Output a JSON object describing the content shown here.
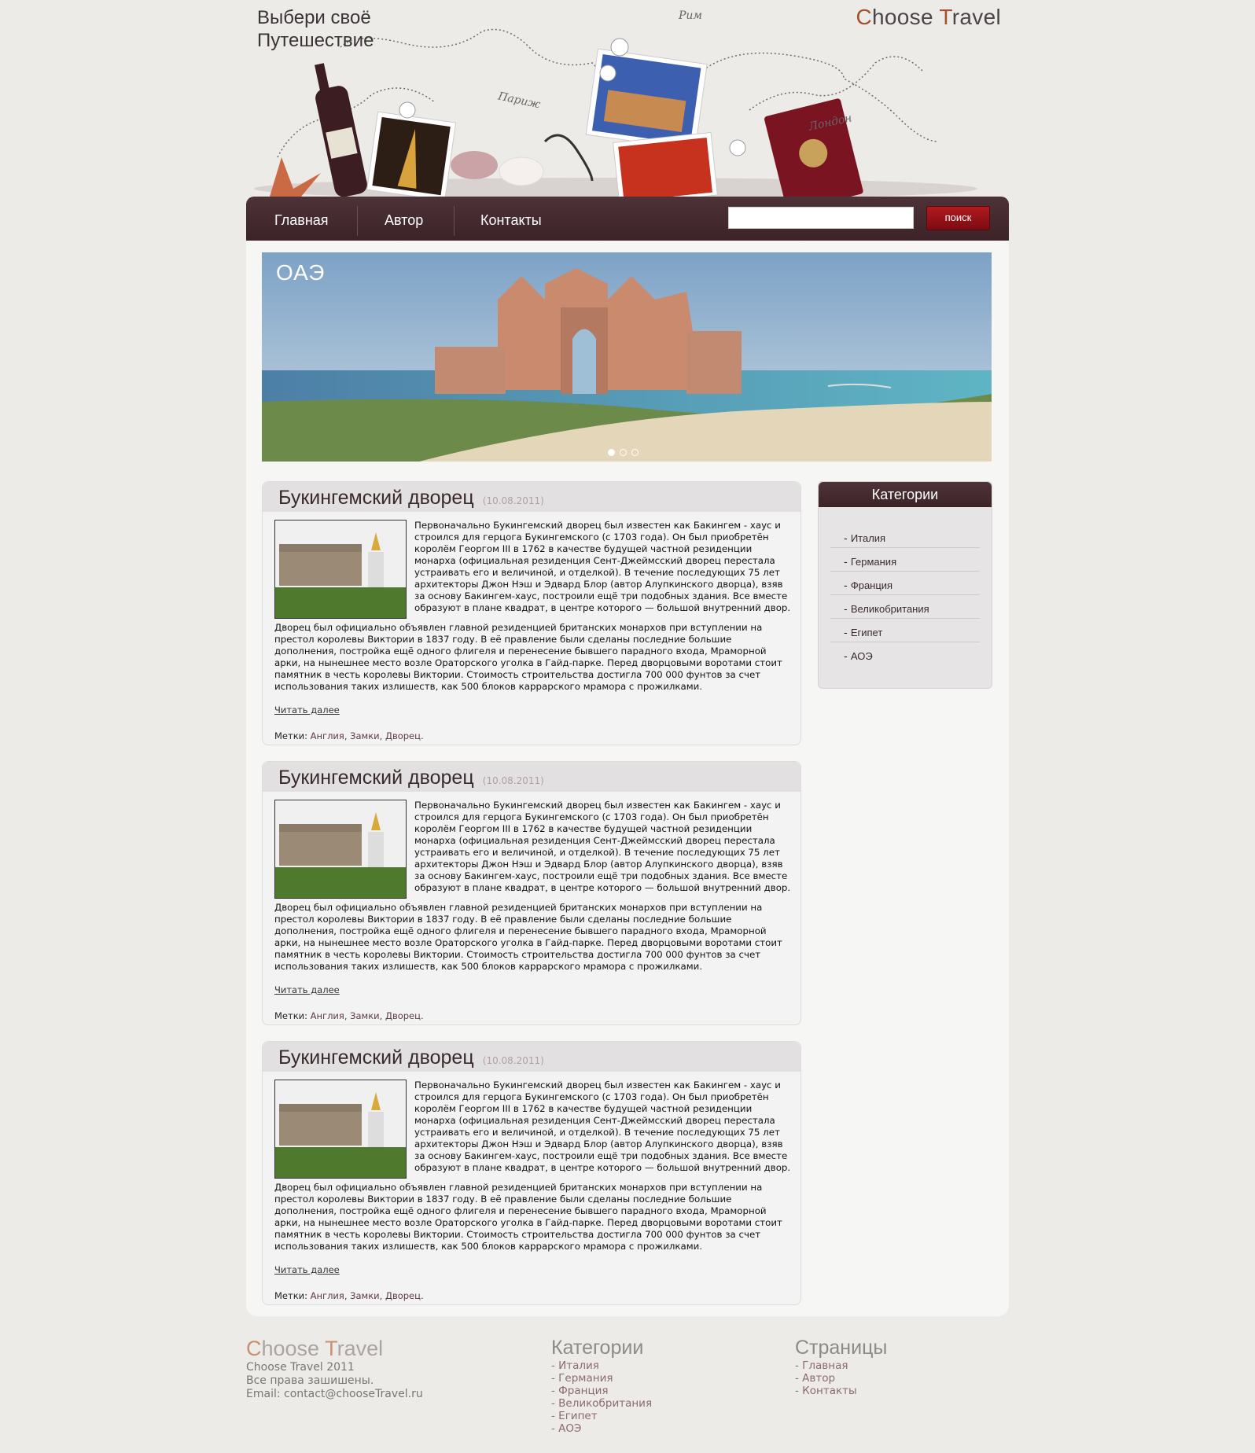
{
  "header": {
    "slogan_line1": "Выбери своё",
    "slogan_line2": "Путешествие",
    "logo_part1": "C",
    "logo_part2": "hoose ",
    "logo_part3": "T",
    "logo_part4": "ravel",
    "city_rome": "Рим",
    "city_paris": "Париж",
    "city_london": "Лондон"
  },
  "nav": {
    "items": [
      {
        "label": "Главная"
      },
      {
        "label": "Автор"
      },
      {
        "label": "Контакты"
      }
    ],
    "search_placeholder": "",
    "search_button": "поиск"
  },
  "banner": {
    "caption": "ОАЭ",
    "slide_count": 3,
    "active_slide": 1
  },
  "posts": [
    {
      "title": "Букингемский дворец",
      "date": "(10.08.2011)",
      "paragraph1": "Первоначально Букингемский дворец был известен как Бакингем - хаус и строился для герцога Букингемского (с 1703 года). Он был приобретён королём Георгом III в 1762 в качестве будущей частной резиденции монарха (официальная резиденция Сент-Джеймсский дворец перестала устраивать его и величиной, и отделкой). В течение последующих 75 лет архитекторы Джон Нэш и Эдвард Блор (автор Алупкинского дворца), взяв за основу Бакингем-хаус, построили ещё три подобных здания. Все вместе образуют в плане квадрат, в центре которого — большой внутренний двор.",
      "paragraph2": "Дворец был официально объявлен главной резиденцией британских монархов при вступлении на престол королевы Виктории в 1837 году. В её правление были сделаны последние большие дополнения, постройка ещё одного флигеля и перенесение бывшего парадного входа, Мраморной арки, на нынешнее место возле Ораторского уголка в Гайд-парке. Перед дворцовыми воротами стоит памятник в честь королевы Виктории. Стоимость строительства достигла 700 000 фунтов за счет использования таких излишеств, как 500 блоков каррарского мрамора с прожилками.",
      "read_more": "Читать далее",
      "tags_label": "Метки:",
      "tags": "Англия, Замки, Дворец."
    },
    {
      "title": "Букингемский дворец",
      "date": "(10.08.2011)",
      "paragraph1": "Первоначально Букингемский дворец был известен как Бакингем - хаус и строился для герцога Букингемского (с 1703 года). Он был приобретён королём Георгом III в 1762 в качестве будущей частной резиденции монарха (официальная резиденция Сент-Джеймсский дворец перестала устраивать его и величиной, и отделкой). В течение последующих 75 лет архитекторы Джон Нэш и Эдвард Блор (автор Алупкинского дворца), взяв за основу Бакингем-хаус, построили ещё три подобных здания. Все вместе образуют в плане квадрат, в центре которого — большой внутренний двор.",
      "paragraph2": "Дворец был официально объявлен главной резиденцией британских монархов при вступлении на престол королевы Виктории в 1837 году. В её правление были сделаны последние большие дополнения, постройка ещё одного флигеля и перенесение бывшего парадного входа, Мраморной арки, на нынешнее место возле Ораторского уголка в Гайд-парке. Перед дворцовыми воротами стоит памятник в честь королевы Виктории. Стоимость строительства достигла 700 000 фунтов за счет использования таких излишеств, как 500 блоков каррарского мрамора с прожилками.",
      "read_more": "Читать далее",
      "tags_label": "Метки:",
      "tags": "Англия, Замки, Дворец."
    },
    {
      "title": "Букингемский дворец",
      "date": "(10.08.2011)",
      "paragraph1": "Первоначально Букингемский дворец был известен как Бакингем - хаус и строился для герцога Букингемского (с 1703 года). Он был приобретён королём Георгом III в 1762 в качестве будущей частной резиденции монарха (официальная резиденция Сент-Джеймсский дворец перестала устраивать его и величиной, и отделкой). В течение последующих 75 лет архитекторы Джон Нэш и Эдвард Блор (автор Алупкинского дворца), взяв за основу Бакингем-хаус, построили ещё три подобных здания. Все вместе образуют в плане квадрат, в центре которого — большой внутренний двор.",
      "paragraph2": "Дворец был официально объявлен главной резиденцией британских монархов при вступлении на престол королевы Виктории в 1837 году. В её правление были сделаны последние большие дополнения, постройка ещё одного флигеля и перенесение бывшего парадного входа, Мраморной арки, на нынешнее место возле Ораторского уголка в Гайд-парке. Перед дворцовыми воротами стоит памятник в честь королевы Виктории. Стоимость строительства достигла 700 000 фунтов за счет использования таких излишеств, как 500 блоков каррарского мрамора с прожилками.",
      "read_more": "Читать далее",
      "tags_label": "Метки:",
      "tags": "Англия, Замки, Дворец."
    }
  ],
  "sidebar": {
    "title": "Категории",
    "items": [
      {
        "label": "Италия"
      },
      {
        "label": "Германия"
      },
      {
        "label": "Франция"
      },
      {
        "label": "Великобритания"
      },
      {
        "label": "Египет"
      },
      {
        "label": "АОЭ"
      }
    ]
  },
  "footer": {
    "logo_part1": "C",
    "logo_part2": "hoose ",
    "logo_part3": "T",
    "logo_part4": "ravel",
    "copyright": "Choose Travel 2011",
    "rights": "Все права зашишены.",
    "email": "Email: contact@chooseTravel.ru",
    "categories_title": "Категории",
    "categories": [
      {
        "label": "Италия"
      },
      {
        "label": "Германия"
      },
      {
        "label": "Франция"
      },
      {
        "label": "Великобритания"
      },
      {
        "label": "Египет"
      },
      {
        "label": "АОЭ"
      }
    ],
    "pages_title": "Страницы",
    "pages": [
      {
        "label": "Главная"
      },
      {
        "label": "Автор"
      },
      {
        "label": "Контакты"
      }
    ]
  },
  "colors": {
    "accent": "#3c2328",
    "search_button": "#9a1218",
    "background": "#edebe7"
  }
}
